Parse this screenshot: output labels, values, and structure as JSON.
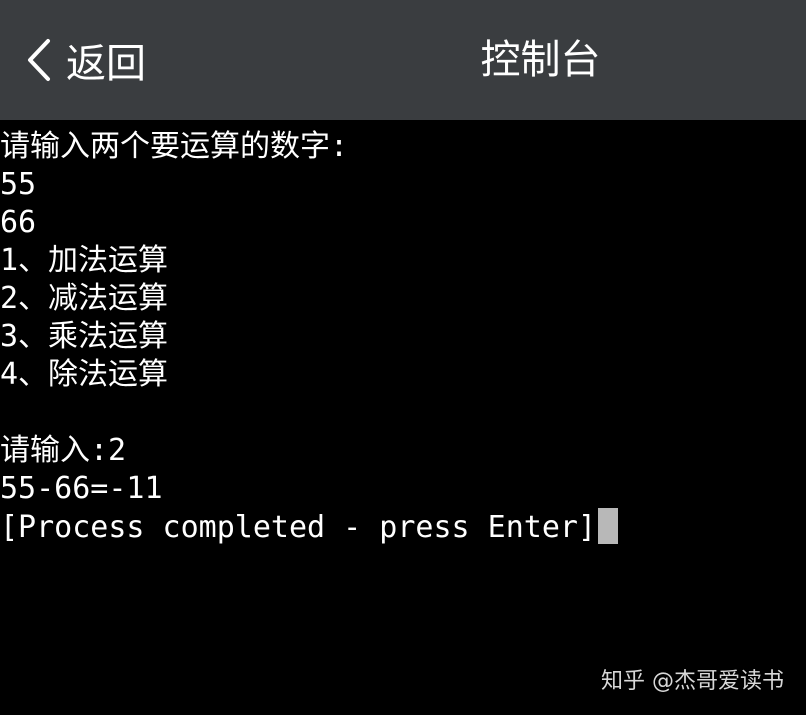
{
  "header": {
    "back_label": "返回",
    "title": "控制台"
  },
  "console": {
    "lines": [
      "请输入两个要运算的数字:",
      "55",
      "66",
      "1、加法运算",
      "2、减法运算",
      "3、乘法运算",
      "4、除法运算",
      "",
      "请输入:2",
      "55-66=-11",
      "[Process completed - press Enter]"
    ]
  },
  "watermark": "知乎 @杰哥爱读书",
  "colors": {
    "header_bg": "#3a3d40",
    "console_bg": "#000000",
    "text": "#ffffff",
    "cursor": "#b8b8b8"
  },
  "icons": {
    "back": "chevron-left-icon"
  }
}
